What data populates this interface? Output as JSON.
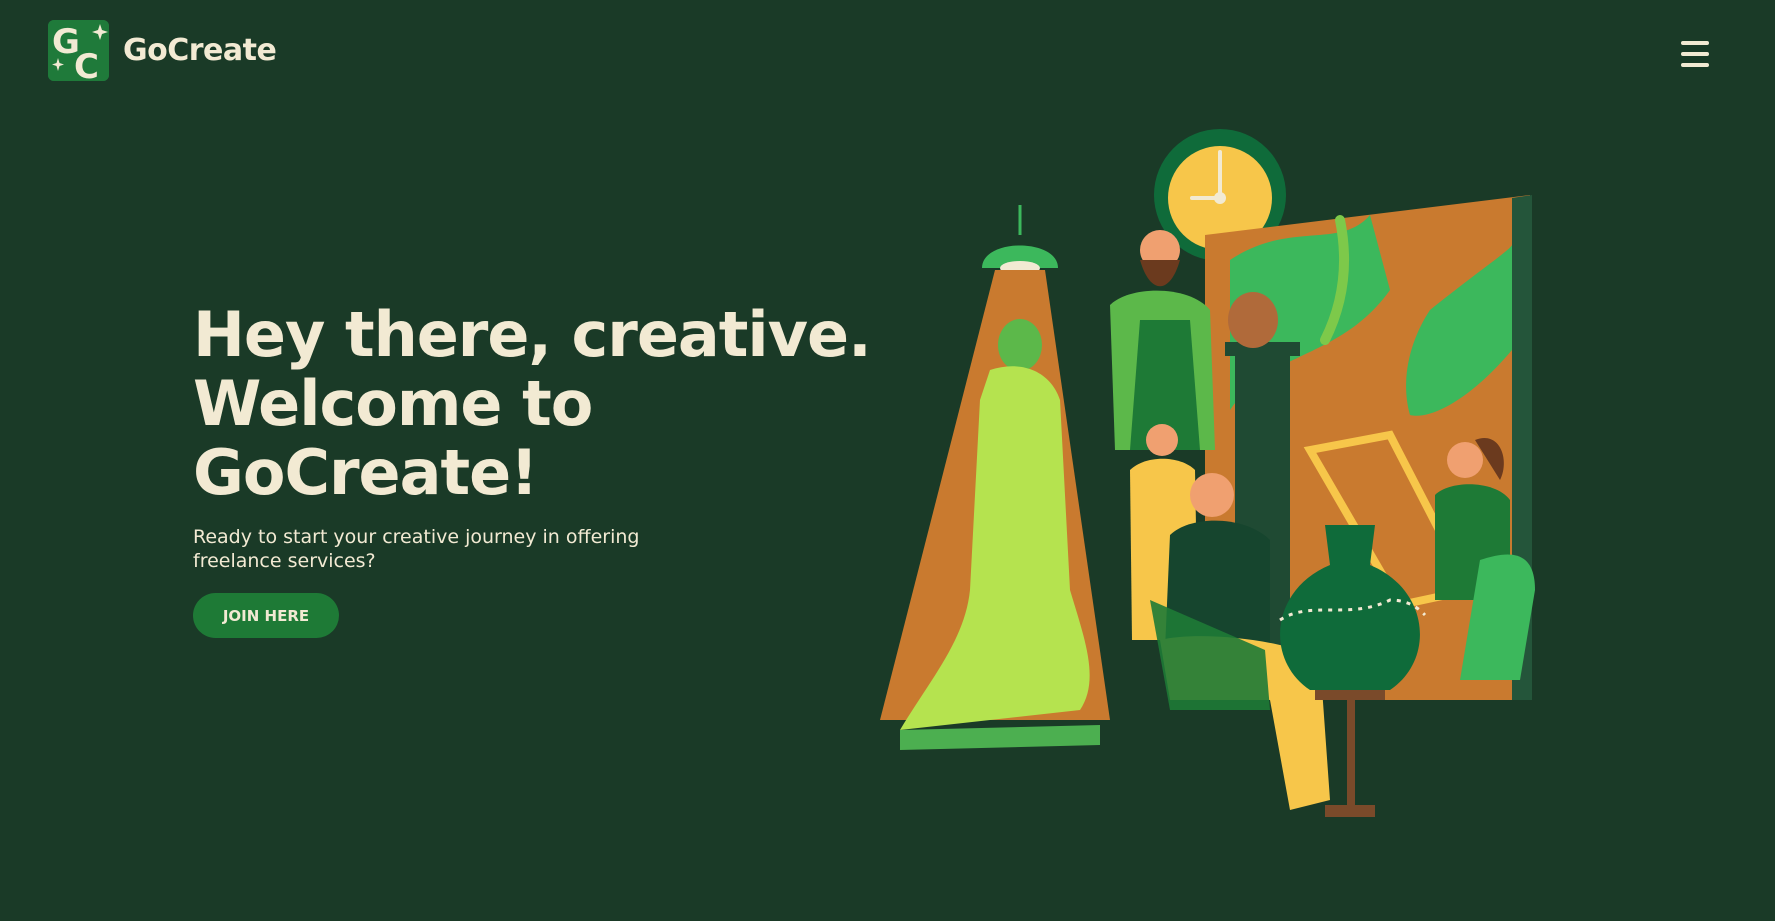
{
  "header": {
    "brand_name": "GoCreate",
    "logo_letters": "GC",
    "menu_icon": "hamburger-menu-icon"
  },
  "hero": {
    "title_lines": [
      "Hey there, creative.",
      "Welcome to",
      "GoCreate!"
    ],
    "subtitle": "Ready to start your creative journey in offering freelance services?",
    "cta_label": "JOIN HERE"
  },
  "illustration": {
    "subject": "artists-studio-illustration"
  },
  "colors": {
    "background": "#1a3a27",
    "text": "#f2ead3",
    "accent": "#1e7a36",
    "orange": "#c97a2f",
    "lime": "#b5e34f",
    "yellow": "#f7c64a"
  }
}
